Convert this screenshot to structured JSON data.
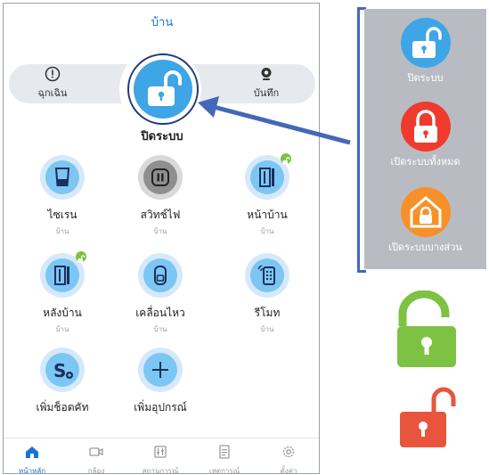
{
  "header": {
    "title": "บ้าน"
  },
  "modes": {
    "left": {
      "label": "ฉุกเฉิน",
      "icon": "alert-icon"
    },
    "center": {
      "label": "ปิดระบบ",
      "icon": "unlock-icon"
    },
    "right": {
      "label": "บันทึก",
      "icon": "camera-icon"
    }
  },
  "devices": [
    {
      "name": "ไซเรน",
      "room": "บ้าน",
      "icon": "siren-icon",
      "style": "blue"
    },
    {
      "name": "สวิทช์ไฟ",
      "room": "บ้าน",
      "icon": "switch-icon",
      "style": "gray"
    },
    {
      "name": "หน้าบ้าน",
      "room": "บ้าน",
      "icon": "door-sensor-icon",
      "style": "blue",
      "lock_badge": true
    },
    {
      "name": "หลังบ้าน",
      "room": "บ้าน",
      "icon": "door-sensor-icon",
      "style": "blue",
      "lock_badge": true
    },
    {
      "name": "เคลื่อนไหว",
      "room": "บ้าน",
      "icon": "motion-sensor-icon",
      "style": "blue"
    },
    {
      "name": "รีโมท",
      "room": "บ้าน",
      "icon": "remote-icon",
      "style": "blue"
    },
    {
      "name": "เพิ่มช็อตคัท",
      "room": "",
      "icon": "shortcut-icon",
      "style": "blue"
    },
    {
      "name": "เพิ่มอุปกรณ์",
      "room": "",
      "icon": "plus-icon",
      "style": "blue"
    }
  ],
  "nav": [
    {
      "label": "หน้าหลัก",
      "icon": "home-icon",
      "active": true
    },
    {
      "label": "กล้อง",
      "icon": "camera-icon",
      "active": false
    },
    {
      "label": "สถานการณ์",
      "icon": "scene-icon",
      "active": false
    },
    {
      "label": "เหตุการณ์",
      "icon": "event-log-icon",
      "active": false
    },
    {
      "label": "ตั้งค่า",
      "icon": "settings-icon",
      "active": false
    }
  ],
  "legend": [
    {
      "label": "ปิดระบบ",
      "color": "#3ea5e6",
      "icon": "unlock-icon"
    },
    {
      "label": "เปิดระบบทั้งหมด",
      "color": "#ee3b2e",
      "icon": "lock-icon"
    },
    {
      "label": "เปิดระบบบางส่วน",
      "color": "#f6912a",
      "icon": "home-lock-icon"
    }
  ],
  "colors": {
    "accent": "#1a73d9",
    "unlocked_green": "#7dc242",
    "unlocked_red": "#e8553c",
    "annotation_arrow": "#4468b8"
  }
}
